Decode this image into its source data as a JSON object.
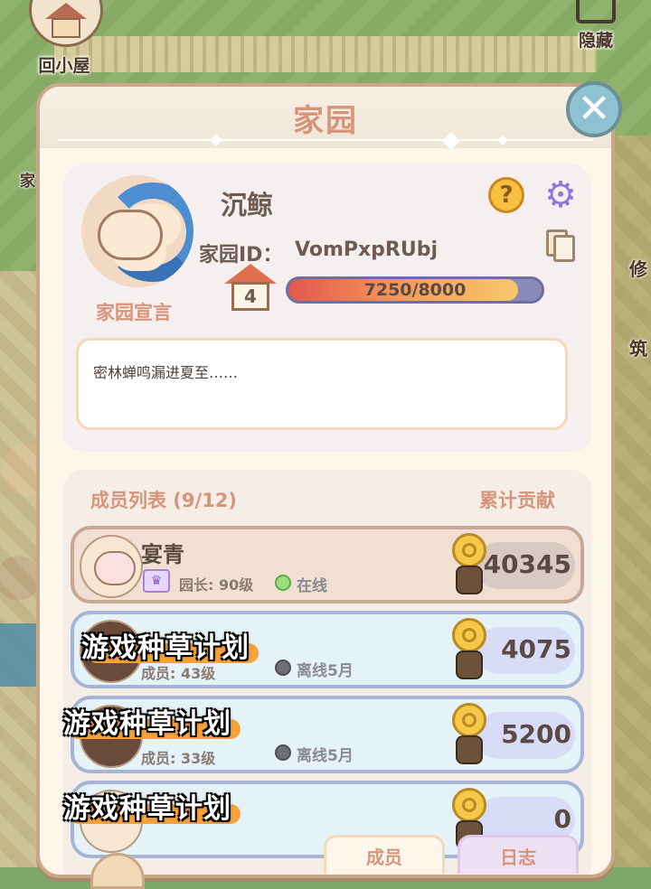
{
  "background": {
    "home_button_label": "回小屋",
    "hide_button_label": "隐藏",
    "left_partial_label": "家",
    "right_partial_labels": [
      "修",
      "筑"
    ]
  },
  "panel": {
    "title": "家园",
    "close_icon": "close-icon"
  },
  "profile": {
    "name": "沉鲸",
    "id_label": "家园ID：",
    "id_value": "VomPxpRUbj",
    "level": "4",
    "progress_text": "7250/8000",
    "progress_fraction": 0.9063,
    "declaration_label": "家园宣言",
    "declaration_text": "密林蝉鸣漏进夏至……",
    "help_glyph": "?",
    "gear_glyph": "⚙"
  },
  "members": {
    "header": "成员列表 (9/12)",
    "contribution_header": "累计贡献",
    "rows": [
      {
        "name": "宴青",
        "role": "园长: 90级",
        "status": "在线",
        "status_type": "online",
        "score": "40345"
      },
      {
        "name": "",
        "role": "成员: 43级",
        "status": "离线5月",
        "status_type": "offline",
        "score": "4075"
      },
      {
        "name": "",
        "role": "成员: 33级",
        "status": "离线5月",
        "status_type": "offline",
        "score": "5200"
      },
      {
        "name": "",
        "role": "",
        "status": "",
        "status_type": "offline",
        "score": "0"
      }
    ]
  },
  "watermark": "游戏种草计划",
  "tabs": {
    "members": "成员",
    "log": "日志"
  },
  "colors": {
    "accent": "#d6957a",
    "panel_bg": "#fdf6ea",
    "progress_start": "#e2584c",
    "progress_end": "#f7c86a"
  }
}
